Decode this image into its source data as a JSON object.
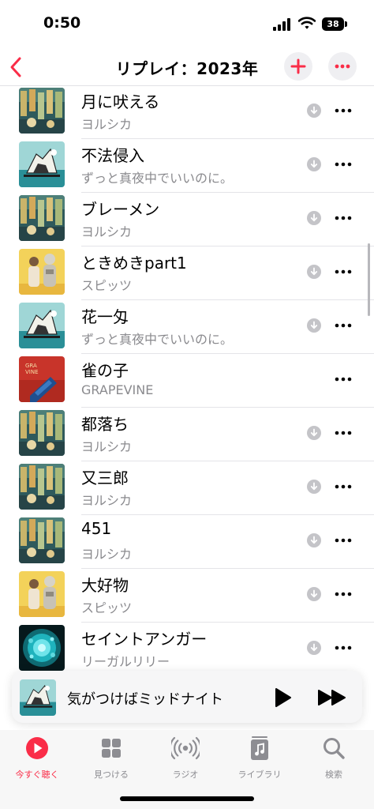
{
  "status": {
    "time": "0:50",
    "battery": "38"
  },
  "header": {
    "title": "リプレイ：2023年"
  },
  "colors": {
    "accent": "#fa2d48",
    "secondary_text": "#8a8a8e",
    "tab_inactive": "#8d8d92"
  },
  "songs": [
    {
      "title": "月に吠える",
      "artist": "ヨルシカ",
      "art": "yorushika",
      "download": true
    },
    {
      "title": "不法侵入",
      "artist": "ずっと真夜中でいいのに。",
      "art": "zutomayo",
      "download": true
    },
    {
      "title": "ブレーメン",
      "artist": "ヨルシカ",
      "art": "yorushika",
      "download": true
    },
    {
      "title": "ときめきpart1",
      "artist": "スピッツ",
      "art": "spitz",
      "download": true
    },
    {
      "title": "花一匁",
      "artist": "ずっと真夜中でいいのに。",
      "art": "zutomayo",
      "download": true
    },
    {
      "title": "雀の子",
      "artist": "GRAPEVINE",
      "art": "grapevine",
      "download": false
    },
    {
      "title": "都落ち",
      "artist": "ヨルシカ",
      "art": "yorushika",
      "download": true
    },
    {
      "title": "又三郎",
      "artist": "ヨルシカ",
      "art": "yorushika",
      "download": true
    },
    {
      "title": "451",
      "artist": "ヨルシカ",
      "art": "yorushika",
      "download": true
    },
    {
      "title": "大好物",
      "artist": "スピッツ",
      "art": "spitz",
      "download": true
    },
    {
      "title": "セイントアンガー",
      "artist": "リーガルリリー",
      "art": "regal",
      "download": true
    }
  ],
  "now_playing": {
    "title": "気がつけばミッドナイト",
    "art": "zutomayo"
  },
  "tabs": [
    {
      "label": "今すぐ聴く",
      "icon": "play-circle-icon",
      "active": true
    },
    {
      "label": "見つける",
      "icon": "grid-icon",
      "active": false
    },
    {
      "label": "ラジオ",
      "icon": "radio-icon",
      "active": false
    },
    {
      "label": "ライブラリ",
      "icon": "music-note-icon",
      "active": false
    },
    {
      "label": "検索",
      "icon": "search-icon",
      "active": false
    }
  ]
}
